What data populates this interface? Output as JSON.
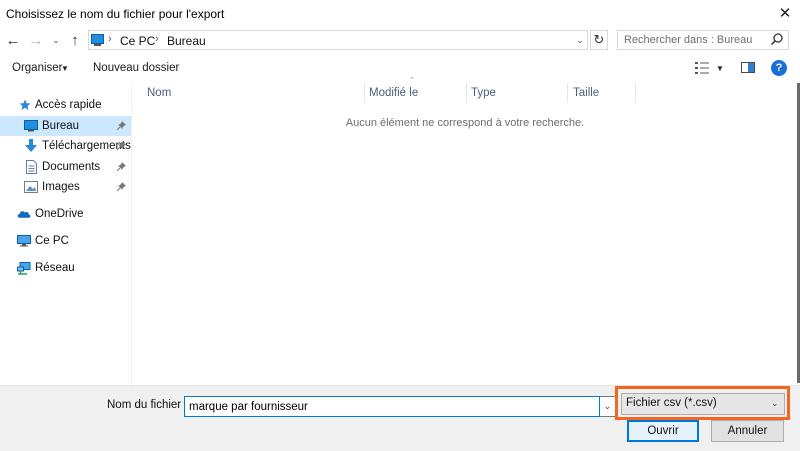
{
  "window": {
    "title": "Choisissez le nom du fichier pour l'export",
    "close_glyph": "✕"
  },
  "navigation": {
    "back_glyph": "←",
    "forward_glyph": "→",
    "recent_glyph": "⌄",
    "up_glyph": "↑",
    "refresh_glyph": "↻"
  },
  "address": {
    "crumbs": [
      "Ce PC",
      "Bureau"
    ],
    "separator": "›",
    "dropdown_glyph": "⌄"
  },
  "search": {
    "placeholder": "Rechercher dans : Bureau"
  },
  "toolbar": {
    "organize_label": "Organiser",
    "organize_caret": "▼",
    "new_folder_label": "Nouveau dossier",
    "view_caret": "▼",
    "help_label": "?"
  },
  "sidebar": {
    "items": [
      {
        "label": "Accès rapide",
        "icon": "star-icon",
        "pinned": false,
        "selected": false
      },
      {
        "label": "Bureau",
        "icon": "desktop-icon",
        "pinned": true,
        "selected": true
      },
      {
        "label": "Téléchargements",
        "icon": "download-icon",
        "pinned": true,
        "selected": false
      },
      {
        "label": "Documents",
        "icon": "document-icon",
        "pinned": true,
        "selected": false
      },
      {
        "label": "Images",
        "icon": "image-icon",
        "pinned": true,
        "selected": false
      },
      {
        "label": "OneDrive",
        "icon": "cloud-icon",
        "pinned": false,
        "selected": false
      },
      {
        "label": "Ce PC",
        "icon": "computer-icon",
        "pinned": false,
        "selected": false
      },
      {
        "label": "Réseau",
        "icon": "network-icon",
        "pinned": false,
        "selected": false
      }
    ],
    "pin_glyph": "📌"
  },
  "file_list": {
    "columns": [
      "Nom",
      "Modifié le",
      "Type",
      "Taille"
    ],
    "empty_message": "Aucun élément ne correspond à votre recherche."
  },
  "footer": {
    "filename_label": "Nom du fichier :",
    "filename_value": "marque par fournisseur",
    "filename_dropdown_glyph": "⌄",
    "filetype_value": "Fichier csv (*.csv)",
    "filetype_caret": "⌄",
    "open_label": "Ouvrir",
    "cancel_label": "Annuler"
  },
  "colors": {
    "accent": "#0078d7",
    "selection": "#cce8ff",
    "highlight_box": "#f26522"
  }
}
